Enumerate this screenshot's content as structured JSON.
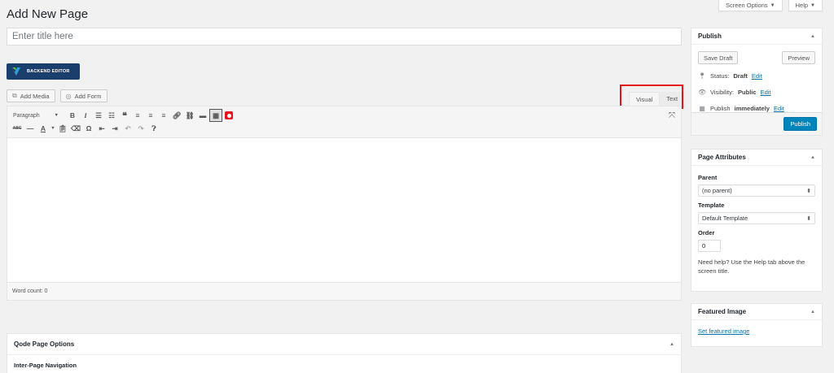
{
  "screen_meta": {
    "screen_options": "Screen Options",
    "help": "Help"
  },
  "page_title": "Add New Page",
  "title_placeholder": "Enter title here",
  "backend_editor_label": "BACKEND EDITOR",
  "media_buttons": {
    "add_media": "Add Media",
    "add_form": "Add Form"
  },
  "editor_tabs": {
    "visual": "Visual",
    "text": "Text"
  },
  "toolbar": {
    "format_select": "Paragraph",
    "row1_icons": [
      "bold-icon",
      "italic-icon",
      "bulleted-list-icon",
      "numbered-list-icon",
      "blockquote-icon",
      "align-left-icon",
      "align-center-icon",
      "align-right-icon",
      "link-icon",
      "unlink-icon",
      "read-more-icon",
      "toolbar-toggle-icon",
      "vc-shortcode-icon"
    ],
    "row2_icons": [
      "strikethrough-icon",
      "horizontal-line-icon",
      "text-color-icon",
      "paste-as-text-icon",
      "clear-formatting-icon",
      "special-character-icon",
      "outdent-icon",
      "indent-icon",
      "undo-icon",
      "redo-icon",
      "keyboard-shortcuts-icon"
    ]
  },
  "word_count": "Word count: 0",
  "qode_box": {
    "title": "Qode Page Options",
    "subheading": "Inter-Page Navigation"
  },
  "publish": {
    "title": "Publish",
    "save_draft": "Save Draft",
    "preview": "Preview",
    "status_label": "Status:",
    "status_value": "Draft",
    "visibility_label": "Visibility:",
    "visibility_value": "Public",
    "publish_label": "Publish",
    "publish_value": "immediately",
    "edit": "Edit",
    "publish_button": "Publish"
  },
  "page_attributes": {
    "title": "Page Attributes",
    "parent_label": "Parent",
    "parent_value": "(no parent)",
    "template_label": "Template",
    "template_value": "Default Template",
    "order_label": "Order",
    "order_value": "0",
    "help_text": "Need help? Use the Help tab above the screen title."
  },
  "featured_image": {
    "title": "Featured Image",
    "link": "Set featured image"
  },
  "colors": {
    "primary": "#0085ba",
    "link": "#0073aa",
    "highlight": "#e8141b",
    "backend_btn": "#1b3f6c"
  }
}
